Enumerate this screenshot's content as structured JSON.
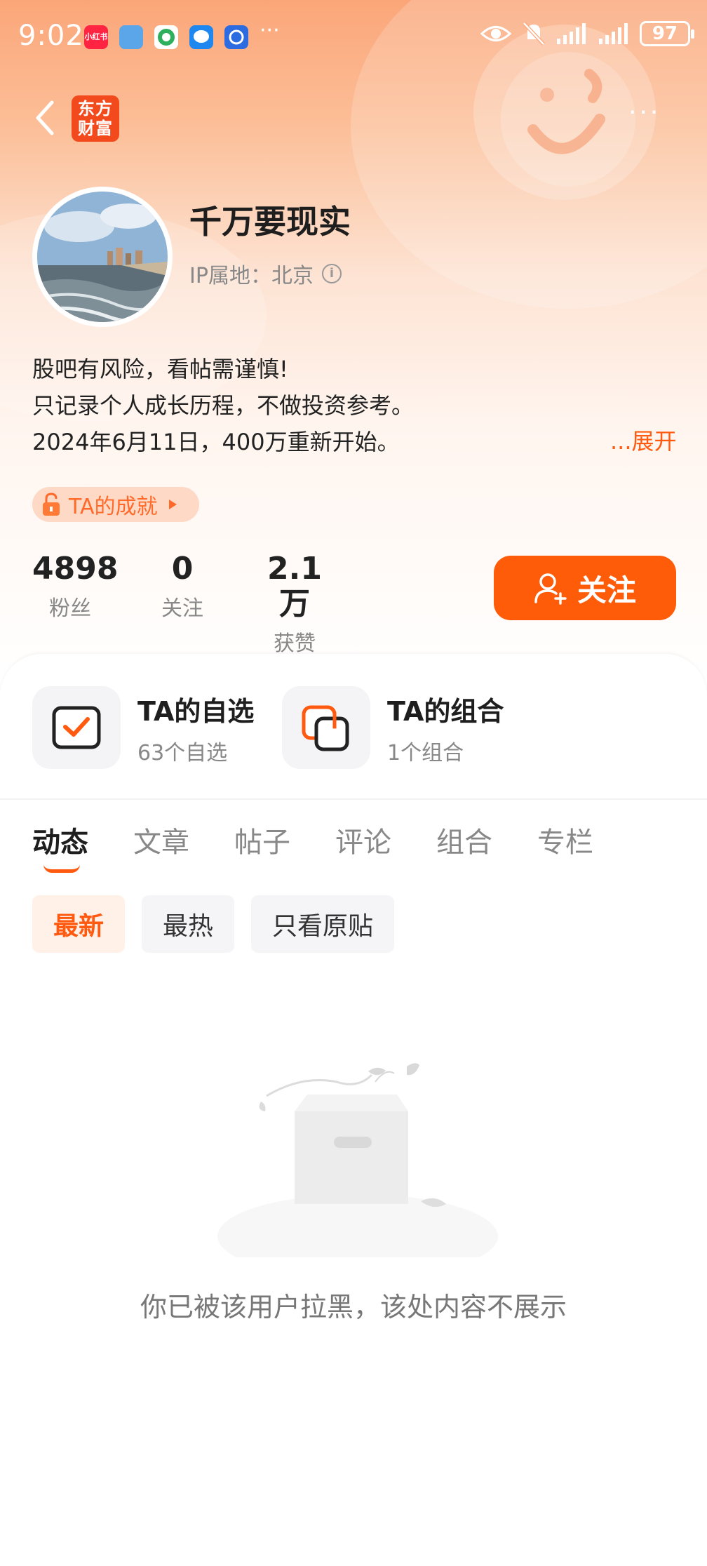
{
  "status_bar": {
    "time": "9:02",
    "app_icons": [
      "xiaohongshu-icon",
      "app-icon-blue",
      "browser-icon",
      "message-icon",
      "app-icon-blue-2"
    ],
    "overflow": "···",
    "battery": "97"
  },
  "header": {
    "logo_text_line1": "东方",
    "logo_text_line2": "财富",
    "more": "···"
  },
  "profile": {
    "name": "千万要现实",
    "ip_location": "IP属地：北京",
    "bio_lines": [
      "股吧有风险，看帖需谨慎!",
      "只记录个人成长历程，不做投资参考。",
      "2024年6月11日，400万重新开始。"
    ],
    "expand_label": "...展开",
    "achievement_label": "TA的成就"
  },
  "stats": [
    {
      "value": "4898",
      "label": "粉丝"
    },
    {
      "value": "0",
      "label": "关注"
    },
    {
      "value": "2.1万",
      "label": "获赞"
    }
  ],
  "follow_button": "关注",
  "shortcuts": [
    {
      "title": "TA的自选",
      "subtitle": "63个自选"
    },
    {
      "title": "TA的组合",
      "subtitle": "1个组合"
    }
  ],
  "tabs": [
    "动态",
    "文章",
    "帖子",
    "评论",
    "组合",
    "专栏"
  ],
  "active_tab": "动态",
  "filters": [
    "最新",
    "最热",
    "只看原贴"
  ],
  "active_filter": "最新",
  "empty_message": "你已被该用户拉黑，该处内容不展示",
  "colors": {
    "accent": "#ff5c0a",
    "hero_gradient_top": "#fba679"
  }
}
